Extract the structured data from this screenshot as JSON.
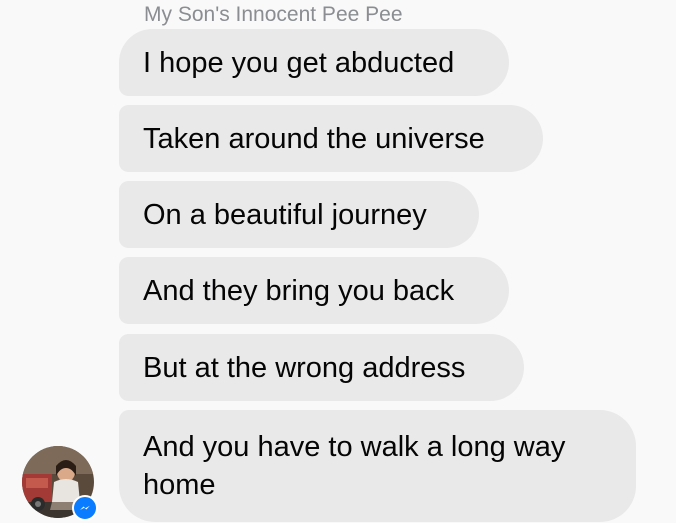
{
  "conversation": {
    "sender_name": "My Son's Innocent Pee Pee",
    "messages": [
      {
        "text": "I hope you get abducted"
      },
      {
        "text": "Taken around the universe"
      },
      {
        "text": "On a beautiful journey"
      },
      {
        "text": "And they bring you back"
      },
      {
        "text": "But at the wrong address"
      },
      {
        "text": "And you have to walk a long way home"
      }
    ]
  },
  "avatar": {
    "icon": "profile-photo",
    "badge_icon": "messenger-icon",
    "badge_color": "#0a7cff"
  },
  "colors": {
    "bubble_bg": "#e9e9ea",
    "text": "#050505",
    "sender_name": "#8a8d91",
    "background": "#f9f9f9"
  }
}
